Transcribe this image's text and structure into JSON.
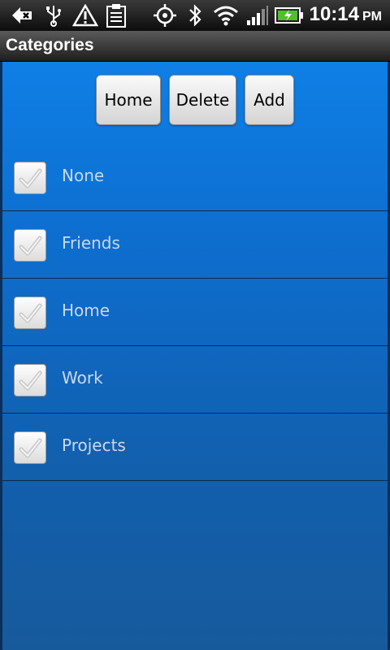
{
  "status_bar": {
    "icons": [
      "back-icon",
      "usb-icon",
      "warning-icon",
      "clipboard-icon",
      "gps-icon",
      "bluetooth-icon",
      "wifi-icon",
      "signal-icon",
      "battery-icon"
    ],
    "time": "10:14",
    "ampm": "PM"
  },
  "app": {
    "title": "Categories"
  },
  "toolbar": {
    "home_label": "Home",
    "delete_label": "Delete",
    "add_label": "Add"
  },
  "categories": [
    {
      "label": "None",
      "checked": true
    },
    {
      "label": "Friends",
      "checked": true
    },
    {
      "label": "Home",
      "checked": true
    },
    {
      "label": "Work",
      "checked": true
    },
    {
      "label": "Projects",
      "checked": true
    }
  ],
  "colors": {
    "content_top": "#0f7fe6",
    "content_bottom": "#175a9c",
    "row_divider": "#0a2a55",
    "row_text": "#c9d9ee"
  }
}
